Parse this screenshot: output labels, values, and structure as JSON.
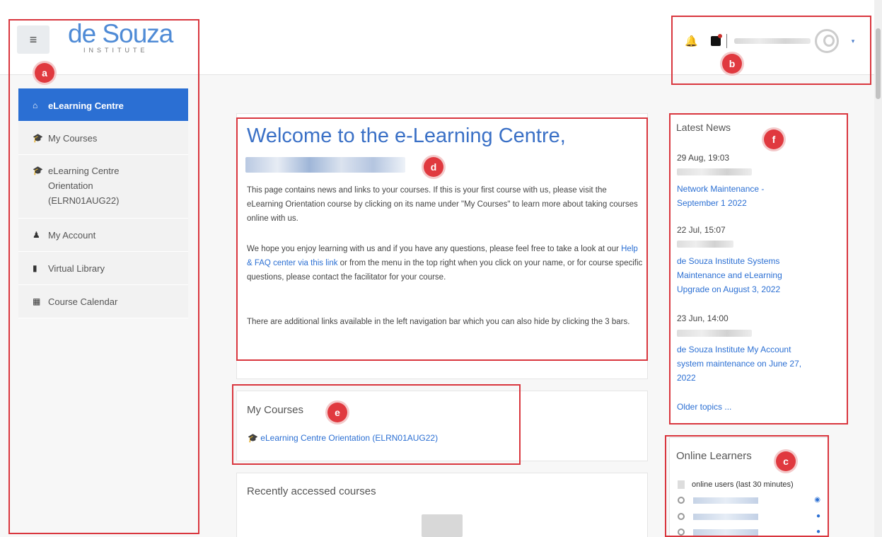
{
  "header": {
    "logo_main": "de Souza",
    "logo_sub": "INSTITUTE",
    "menu_icon": "≡",
    "caret": "▾"
  },
  "sidebar": {
    "items": [
      {
        "icon": "dashboard-icon",
        "glyph": "⌂",
        "label": "eLearning Centre"
      },
      {
        "icon": "graduation-cap-icon",
        "glyph": "🎓",
        "label": "My Courses"
      },
      {
        "icon": "graduation-cap-icon",
        "glyph": "🎓",
        "label": "eLearning Centre Orientation (ELRN01AUG22)"
      },
      {
        "icon": "user-icon",
        "glyph": "♟",
        "label": "My Account"
      },
      {
        "icon": "book-icon",
        "glyph": "▮",
        "label": "Virtual Library"
      },
      {
        "icon": "calendar-icon",
        "glyph": "▦",
        "label": "Course Calendar"
      }
    ]
  },
  "welcome": {
    "title": "Welcome to the e-Learning Centre,",
    "p1": "This page contains news and links to your courses. If this is your first course with us, please visit the eLearning Orientation course by clicking on its name under \"My Courses\" to learn more about taking courses online with us.",
    "p2_a": "We hope you enjoy learning with us and if you have any questions, please feel free to take a look at our ",
    "p2_link": "Help & FAQ center via this link",
    "p2_b": " or from the menu in the top right when you click on your name, or for course specific questions, please contact the facilitator for your course.",
    "p3": "There are additional links available in the left navigation bar which you can also hide by clicking the 3 bars."
  },
  "my_courses": {
    "title": "My Courses",
    "course": "eLearning Centre Orientation (ELRN01AUG22)"
  },
  "recent": {
    "title": "Recently accessed courses"
  },
  "news": {
    "title": "Latest News",
    "items": [
      {
        "date": "29 Aug, 19:03",
        "title": "Network Maintenance - September 1 2022"
      },
      {
        "date": "22 Jul, 15:07",
        "title": "de Souza Institute Systems Maintenance and eLearning Upgrade on August 3, 2022"
      },
      {
        "date": "23 Jun, 14:00",
        "title": "de Souza Institute My Account system maintenance on June 27, 2022"
      }
    ],
    "older": "Older topics ..."
  },
  "online": {
    "title": "Online Learners",
    "count_text": "online users (last 30 minutes)"
  },
  "annotations": {
    "a": "a",
    "b": "b",
    "c": "c",
    "d": "d",
    "e": "e",
    "f": "f"
  }
}
